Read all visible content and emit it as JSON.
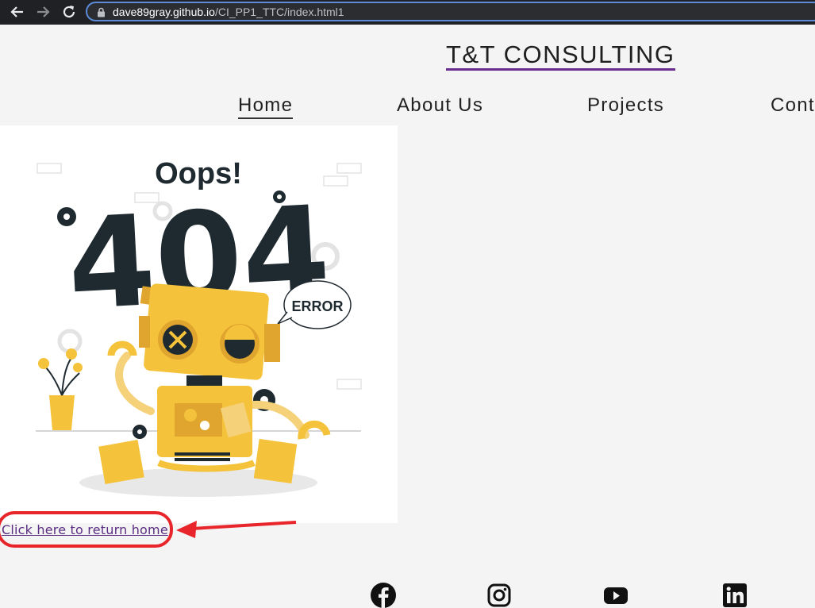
{
  "browser": {
    "url_host": "dave89gray.github.io",
    "url_path": "/CI_PP1_TTC/index.html1"
  },
  "site": {
    "title": "T&T CONSULTING"
  },
  "nav": {
    "home": "Home",
    "about": "About Us",
    "projects": "Projects",
    "contact": "Cont"
  },
  "illustration": {
    "heading": "Oops!",
    "code": "404",
    "bubble": "ERROR"
  },
  "main": {
    "return_link": "Click here to return home"
  },
  "footer": {
    "social": [
      "facebook-icon",
      "instagram-icon",
      "youtube-icon",
      "linkedin-icon"
    ]
  },
  "colors": {
    "title_underline": "#6a2c8f",
    "link": "#5a2d82",
    "annotation": "#e8252a",
    "robot_yellow": "#f5c33b",
    "dark": "#1f2a30"
  }
}
